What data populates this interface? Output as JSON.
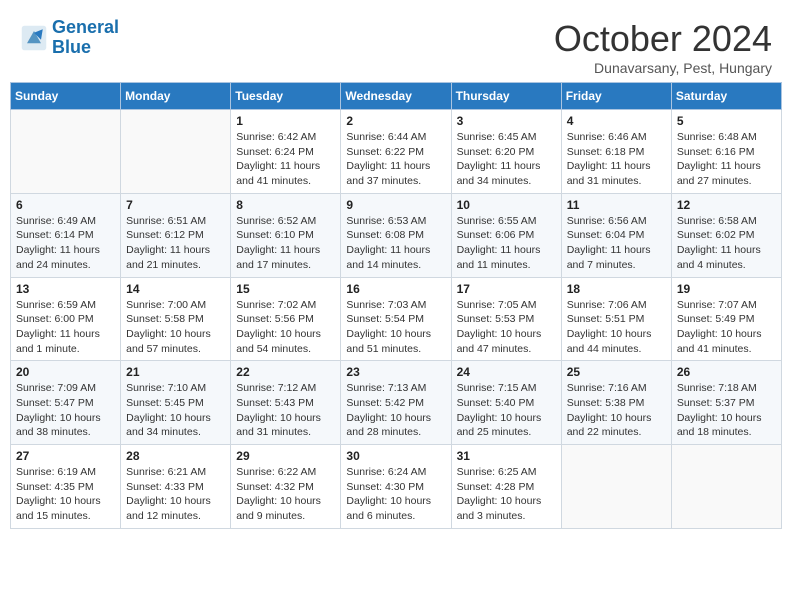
{
  "logo": {
    "text_general": "General",
    "text_blue": "Blue"
  },
  "header": {
    "month": "October 2024",
    "location": "Dunavarsany, Pest, Hungary"
  },
  "weekdays": [
    "Sunday",
    "Monday",
    "Tuesday",
    "Wednesday",
    "Thursday",
    "Friday",
    "Saturday"
  ],
  "weeks": [
    [
      null,
      null,
      {
        "day": "1",
        "sunrise": "Sunrise: 6:42 AM",
        "sunset": "Sunset: 6:24 PM",
        "daylight": "Daylight: 11 hours and 41 minutes."
      },
      {
        "day": "2",
        "sunrise": "Sunrise: 6:44 AM",
        "sunset": "Sunset: 6:22 PM",
        "daylight": "Daylight: 11 hours and 37 minutes."
      },
      {
        "day": "3",
        "sunrise": "Sunrise: 6:45 AM",
        "sunset": "Sunset: 6:20 PM",
        "daylight": "Daylight: 11 hours and 34 minutes."
      },
      {
        "day": "4",
        "sunrise": "Sunrise: 6:46 AM",
        "sunset": "Sunset: 6:18 PM",
        "daylight": "Daylight: 11 hours and 31 minutes."
      },
      {
        "day": "5",
        "sunrise": "Sunrise: 6:48 AM",
        "sunset": "Sunset: 6:16 PM",
        "daylight": "Daylight: 11 hours and 27 minutes."
      }
    ],
    [
      {
        "day": "6",
        "sunrise": "Sunrise: 6:49 AM",
        "sunset": "Sunset: 6:14 PM",
        "daylight": "Daylight: 11 hours and 24 minutes."
      },
      {
        "day": "7",
        "sunrise": "Sunrise: 6:51 AM",
        "sunset": "Sunset: 6:12 PM",
        "daylight": "Daylight: 11 hours and 21 minutes."
      },
      {
        "day": "8",
        "sunrise": "Sunrise: 6:52 AM",
        "sunset": "Sunset: 6:10 PM",
        "daylight": "Daylight: 11 hours and 17 minutes."
      },
      {
        "day": "9",
        "sunrise": "Sunrise: 6:53 AM",
        "sunset": "Sunset: 6:08 PM",
        "daylight": "Daylight: 11 hours and 14 minutes."
      },
      {
        "day": "10",
        "sunrise": "Sunrise: 6:55 AM",
        "sunset": "Sunset: 6:06 PM",
        "daylight": "Daylight: 11 hours and 11 minutes."
      },
      {
        "day": "11",
        "sunrise": "Sunrise: 6:56 AM",
        "sunset": "Sunset: 6:04 PM",
        "daylight": "Daylight: 11 hours and 7 minutes."
      },
      {
        "day": "12",
        "sunrise": "Sunrise: 6:58 AM",
        "sunset": "Sunset: 6:02 PM",
        "daylight": "Daylight: 11 hours and 4 minutes."
      }
    ],
    [
      {
        "day": "13",
        "sunrise": "Sunrise: 6:59 AM",
        "sunset": "Sunset: 6:00 PM",
        "daylight": "Daylight: 11 hours and 1 minute."
      },
      {
        "day": "14",
        "sunrise": "Sunrise: 7:00 AM",
        "sunset": "Sunset: 5:58 PM",
        "daylight": "Daylight: 10 hours and 57 minutes."
      },
      {
        "day": "15",
        "sunrise": "Sunrise: 7:02 AM",
        "sunset": "Sunset: 5:56 PM",
        "daylight": "Daylight: 10 hours and 54 minutes."
      },
      {
        "day": "16",
        "sunrise": "Sunrise: 7:03 AM",
        "sunset": "Sunset: 5:54 PM",
        "daylight": "Daylight: 10 hours and 51 minutes."
      },
      {
        "day": "17",
        "sunrise": "Sunrise: 7:05 AM",
        "sunset": "Sunset: 5:53 PM",
        "daylight": "Daylight: 10 hours and 47 minutes."
      },
      {
        "day": "18",
        "sunrise": "Sunrise: 7:06 AM",
        "sunset": "Sunset: 5:51 PM",
        "daylight": "Daylight: 10 hours and 44 minutes."
      },
      {
        "day": "19",
        "sunrise": "Sunrise: 7:07 AM",
        "sunset": "Sunset: 5:49 PM",
        "daylight": "Daylight: 10 hours and 41 minutes."
      }
    ],
    [
      {
        "day": "20",
        "sunrise": "Sunrise: 7:09 AM",
        "sunset": "Sunset: 5:47 PM",
        "daylight": "Daylight: 10 hours and 38 minutes."
      },
      {
        "day": "21",
        "sunrise": "Sunrise: 7:10 AM",
        "sunset": "Sunset: 5:45 PM",
        "daylight": "Daylight: 10 hours and 34 minutes."
      },
      {
        "day": "22",
        "sunrise": "Sunrise: 7:12 AM",
        "sunset": "Sunset: 5:43 PM",
        "daylight": "Daylight: 10 hours and 31 minutes."
      },
      {
        "day": "23",
        "sunrise": "Sunrise: 7:13 AM",
        "sunset": "Sunset: 5:42 PM",
        "daylight": "Daylight: 10 hours and 28 minutes."
      },
      {
        "day": "24",
        "sunrise": "Sunrise: 7:15 AM",
        "sunset": "Sunset: 5:40 PM",
        "daylight": "Daylight: 10 hours and 25 minutes."
      },
      {
        "day": "25",
        "sunrise": "Sunrise: 7:16 AM",
        "sunset": "Sunset: 5:38 PM",
        "daylight": "Daylight: 10 hours and 22 minutes."
      },
      {
        "day": "26",
        "sunrise": "Sunrise: 7:18 AM",
        "sunset": "Sunset: 5:37 PM",
        "daylight": "Daylight: 10 hours and 18 minutes."
      }
    ],
    [
      {
        "day": "27",
        "sunrise": "Sunrise: 6:19 AM",
        "sunset": "Sunset: 4:35 PM",
        "daylight": "Daylight: 10 hours and 15 minutes."
      },
      {
        "day": "28",
        "sunrise": "Sunrise: 6:21 AM",
        "sunset": "Sunset: 4:33 PM",
        "daylight": "Daylight: 10 hours and 12 minutes."
      },
      {
        "day": "29",
        "sunrise": "Sunrise: 6:22 AM",
        "sunset": "Sunset: 4:32 PM",
        "daylight": "Daylight: 10 hours and 9 minutes."
      },
      {
        "day": "30",
        "sunrise": "Sunrise: 6:24 AM",
        "sunset": "Sunset: 4:30 PM",
        "daylight": "Daylight: 10 hours and 6 minutes."
      },
      {
        "day": "31",
        "sunrise": "Sunrise: 6:25 AM",
        "sunset": "Sunset: 4:28 PM",
        "daylight": "Daylight: 10 hours and 3 minutes."
      },
      null,
      null
    ]
  ]
}
